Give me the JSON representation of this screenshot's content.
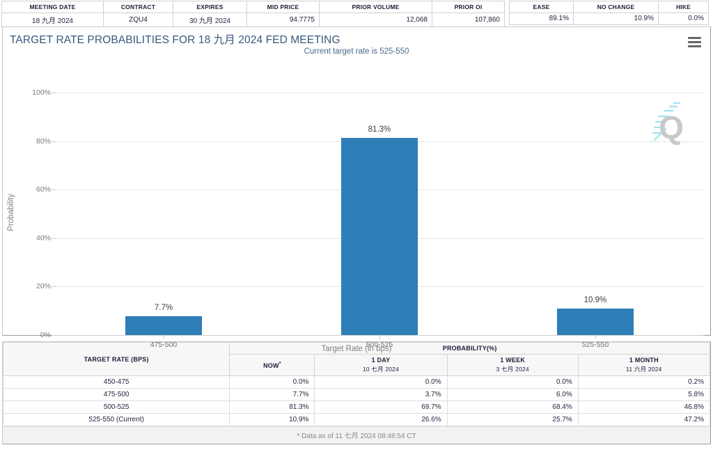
{
  "summary": {
    "left_headers": [
      "MEETING DATE",
      "CONTRACT",
      "EXPIRES",
      "MID PRICE",
      "PRIOR VOLUME",
      "PRIOR OI"
    ],
    "left_values": [
      "18 九月 2024",
      "ZQU4",
      "30 九月 2024",
      "94.7775",
      "12,068",
      "107,860"
    ],
    "right_headers": [
      "EASE",
      "NO CHANGE",
      "HIKE"
    ],
    "right_values": [
      "89.1%",
      "10.9%",
      "0.0%"
    ]
  },
  "chart": {
    "title": "TARGET RATE PROBABILITIES FOR 18 九月 2024 FED MEETING",
    "subtitle": "Current target rate is 525-550",
    "menu_icon": "hamburger-menu-icon",
    "watermark": "quikstrike-q-logo"
  },
  "chart_data": {
    "type": "bar",
    "title": "TARGET RATE PROBABILITIES FOR 18 九月 2024 FED MEETING",
    "subtitle": "Current target rate is 525-550",
    "xlabel": "Target Rate (in bps)",
    "ylabel": "Probability",
    "categories": [
      "475-500",
      "500-525",
      "525-550"
    ],
    "values": [
      7.7,
      81.3,
      10.9
    ],
    "value_labels": [
      "7.7%",
      "81.3%",
      "10.9%"
    ],
    "ylim": [
      0,
      100
    ],
    "yticks": [
      0,
      20,
      40,
      60,
      80,
      100
    ],
    "ytick_labels": [
      "0%",
      "20%",
      "40%",
      "60%",
      "80%",
      "100%"
    ],
    "grid": true,
    "legend": false,
    "bar_color": "#2e7eb8"
  },
  "prob_table": {
    "col_rate": "TARGET RATE (BPS)",
    "group_header": "PROBABILITY(%)",
    "columns": [
      {
        "label": "NOW",
        "sub": "",
        "star": true
      },
      {
        "label": "1 DAY",
        "sub": "10 七月 2024",
        "star": false
      },
      {
        "label": "1 WEEK",
        "sub": "3 七月 2024",
        "star": false
      },
      {
        "label": "1 MONTH",
        "sub": "11 六月 2024",
        "star": false
      }
    ],
    "rows": [
      {
        "rate": "450-475",
        "now": "0.0%",
        "day": "0.0%",
        "week": "0.0%",
        "month": "0.2%"
      },
      {
        "rate": "475-500",
        "now": "7.7%",
        "day": "3.7%",
        "week": "6.0%",
        "month": "5.8%"
      },
      {
        "rate": "500-525",
        "now": "81.3%",
        "day": "69.7%",
        "week": "68.4%",
        "month": "46.8%"
      },
      {
        "rate": "525-550 (Current)",
        "now": "10.9%",
        "day": "26.6%",
        "week": "25.7%",
        "month": "47.2%"
      }
    ],
    "footnote": "* Data as of 11 七月 2024 08:48:54 CT"
  }
}
